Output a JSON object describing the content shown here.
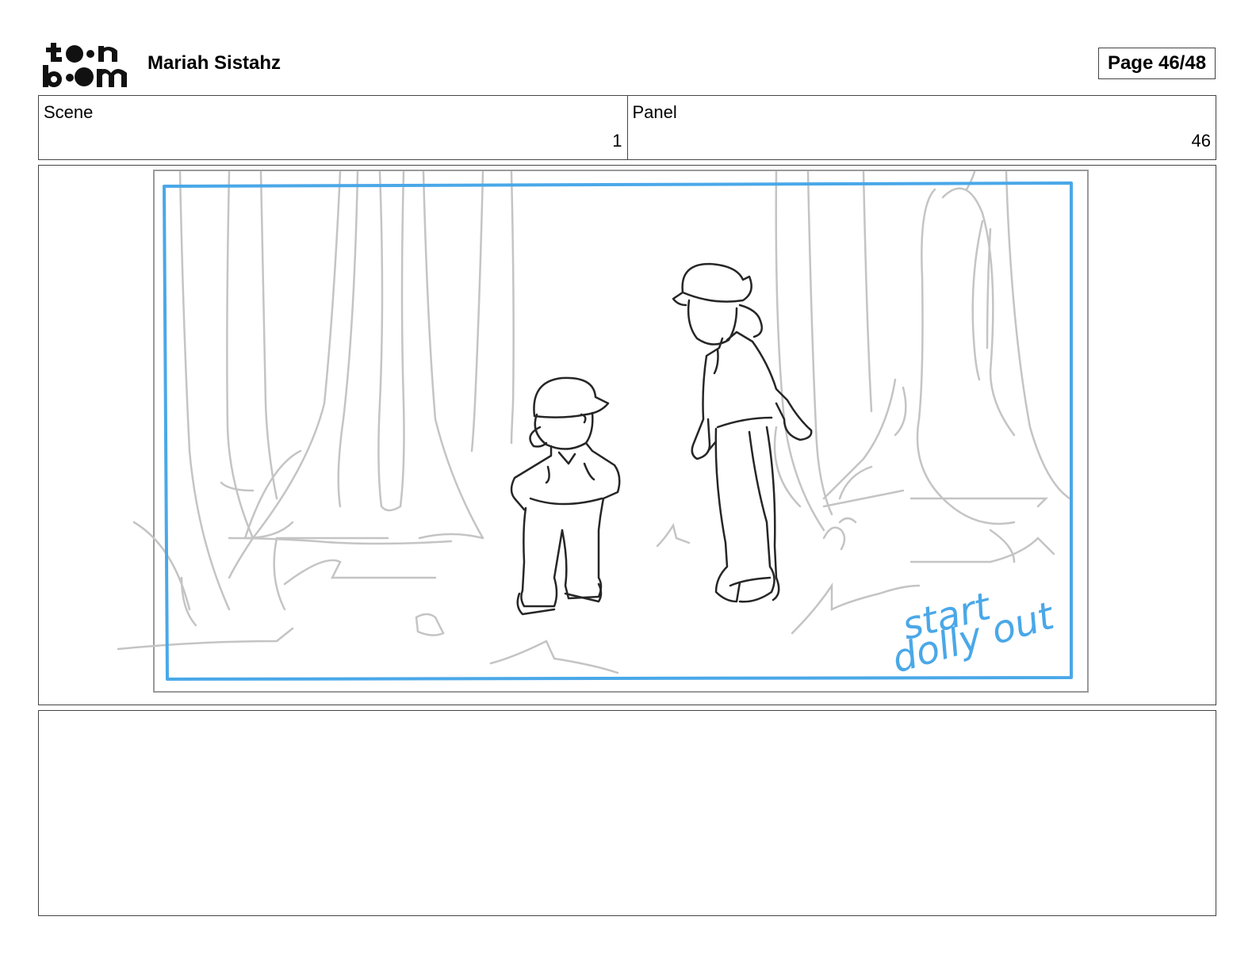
{
  "header": {
    "logo": {
      "icon": "toon-boom-logo-icon",
      "lettering": "toon boom"
    },
    "project_title": "Mariah Sistahz",
    "page_counter": "Page 46/48"
  },
  "info": {
    "scene": {
      "label": "Scene",
      "value": "1"
    },
    "panel": {
      "label": "Panel",
      "value": "46"
    }
  },
  "artwork": {
    "annotation_line1": "start",
    "annotation_line2": "dolly out",
    "colors": {
      "camera_frame": "#4aa8e8",
      "background_sketch": "#c4c4c4",
      "character_lines": "#262626"
    }
  },
  "notes": {
    "text": ""
  }
}
